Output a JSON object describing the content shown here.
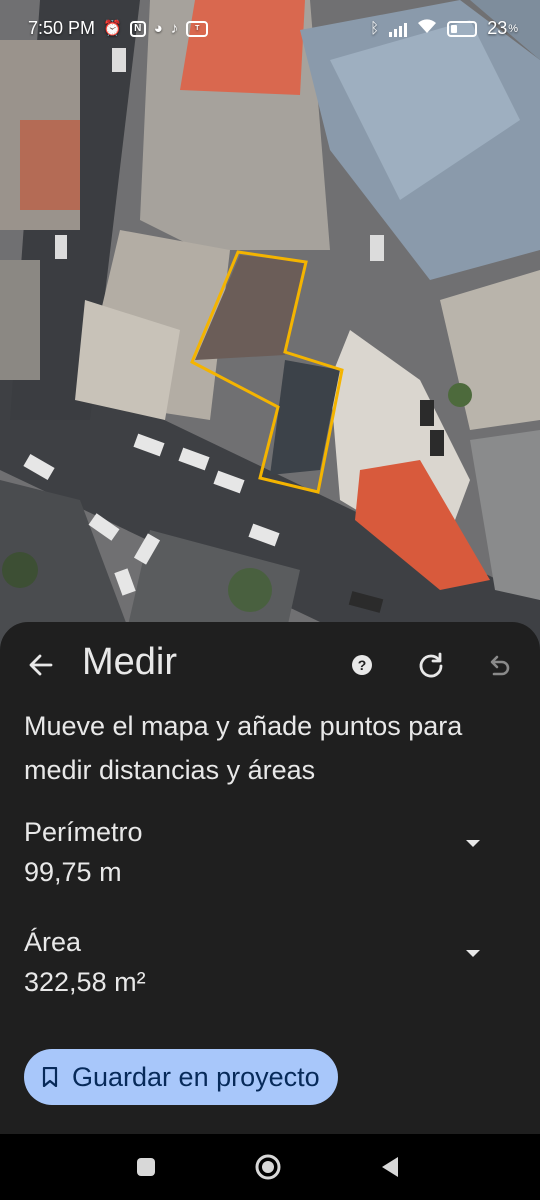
{
  "status_bar": {
    "time": "7:50 PM",
    "battery_level": "23",
    "icons": [
      "alarm-icon",
      "nfc-icon",
      "messenger-icon",
      "tiktok-icon",
      "temu-icon",
      "bluetooth-icon",
      "signal-icon",
      "wifi-icon",
      "battery-icon"
    ]
  },
  "map": {
    "type": "satellite",
    "measured_polygon_color": "#f4b400"
  },
  "header": {
    "title": "Medir",
    "icons": [
      "back-arrow-icon",
      "help-icon",
      "refresh-icon",
      "undo-icon"
    ]
  },
  "instructions": "Mueve el mapa y añade puntos para medir distancias y áreas",
  "metrics": {
    "perimeter": {
      "label": "Perímetro",
      "value": "99,75 m"
    },
    "area": {
      "label": "Área",
      "value": "322,58 m²"
    }
  },
  "actions": {
    "save_label": "Guardar en proyecto"
  },
  "nav_bar": {
    "icons": [
      "recents-icon",
      "home-icon",
      "back-icon"
    ]
  },
  "colors": {
    "sheet_bg": "#1f1f1f",
    "save_button_bg": "#a8c7fa",
    "save_button_text": "#072a59"
  }
}
